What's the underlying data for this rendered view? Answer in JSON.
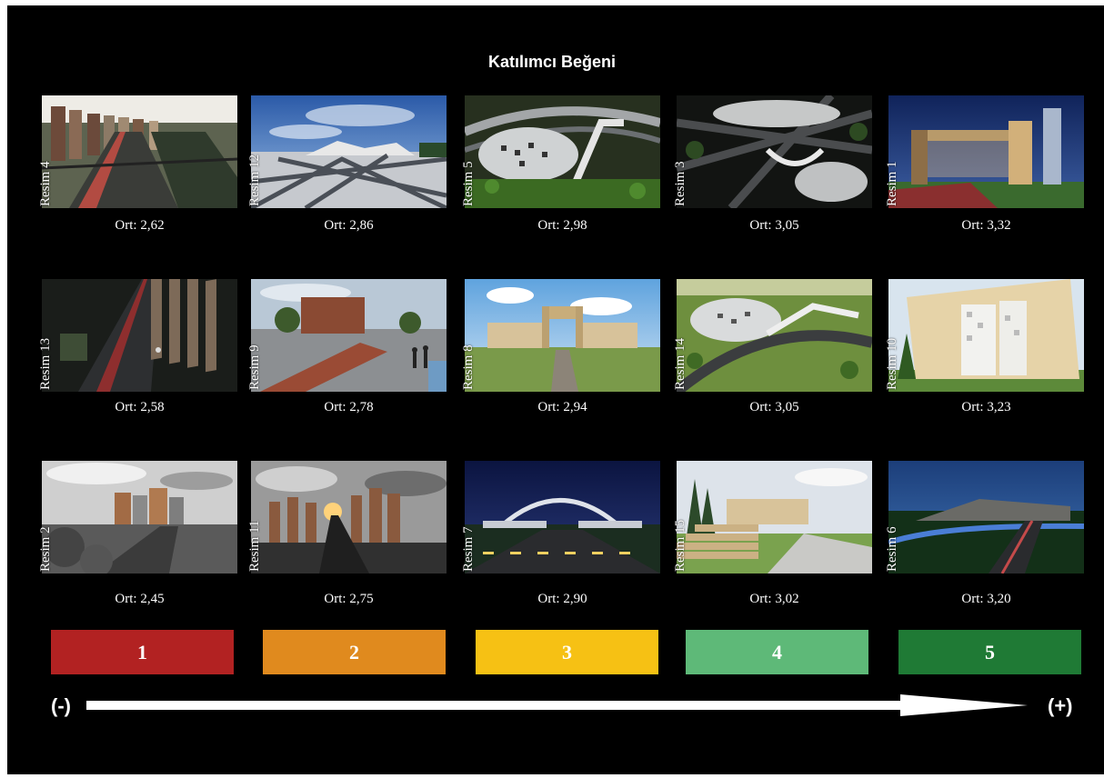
{
  "title": "Katılımcı Beğeni",
  "rows": [
    {
      "cells": [
        {
          "label": "Resim 4",
          "avg": "Ort: 2,62",
          "scene": "street-day"
        },
        {
          "label": "Resim 12",
          "avg": "Ort: 2,86",
          "scene": "plaza-sky"
        },
        {
          "label": "Resim 5",
          "avg": "Ort: 2,98",
          "scene": "aerial-night"
        },
        {
          "label": "Resim 3",
          "avg": "Ort: 3,05",
          "scene": "aerial-dark"
        },
        {
          "label": "Resim 1",
          "avg": "Ort: 3,32",
          "scene": "gate-night"
        }
      ]
    },
    {
      "cells": [
        {
          "label": "Resim 13",
          "avg": "Ort: 2,58",
          "scene": "street-night"
        },
        {
          "label": "Resim 9",
          "avg": "Ort: 2,78",
          "scene": "plaza-people"
        },
        {
          "label": "Resim 8",
          "avg": "Ort: 2,94",
          "scene": "gate-day"
        },
        {
          "label": "Resim 14",
          "avg": "Ort: 3,05",
          "scene": "aerial-day"
        },
        {
          "label": "Resim 10",
          "avg": "Ort: 3,23",
          "scene": "building-day"
        }
      ]
    },
    {
      "cells": [
        {
          "label": "Resim 2",
          "avg": "Ort: 2,45",
          "scene": "street-bw"
        },
        {
          "label": "Resim 11",
          "avg": "Ort: 2,75",
          "scene": "sunset-bw"
        },
        {
          "label": "Resim 7",
          "avg": "Ort: 2,90",
          "scene": "road-night"
        },
        {
          "label": "Resim 15",
          "avg": "Ort: 3,02",
          "scene": "steps-day"
        },
        {
          "label": "Resim 6",
          "avg": "Ort: 3,20",
          "scene": "road-dusk"
        }
      ]
    }
  ],
  "scale": [
    {
      "label": "1",
      "color": "#b22222"
    },
    {
      "label": "2",
      "color": "#e08a1e"
    },
    {
      "label": "3",
      "color": "#f6c114"
    },
    {
      "label": "4",
      "color": "#5eb978"
    },
    {
      "label": "5",
      "color": "#1f7a35"
    }
  ],
  "arrow": {
    "left": "(-)",
    "right": "(+)"
  }
}
